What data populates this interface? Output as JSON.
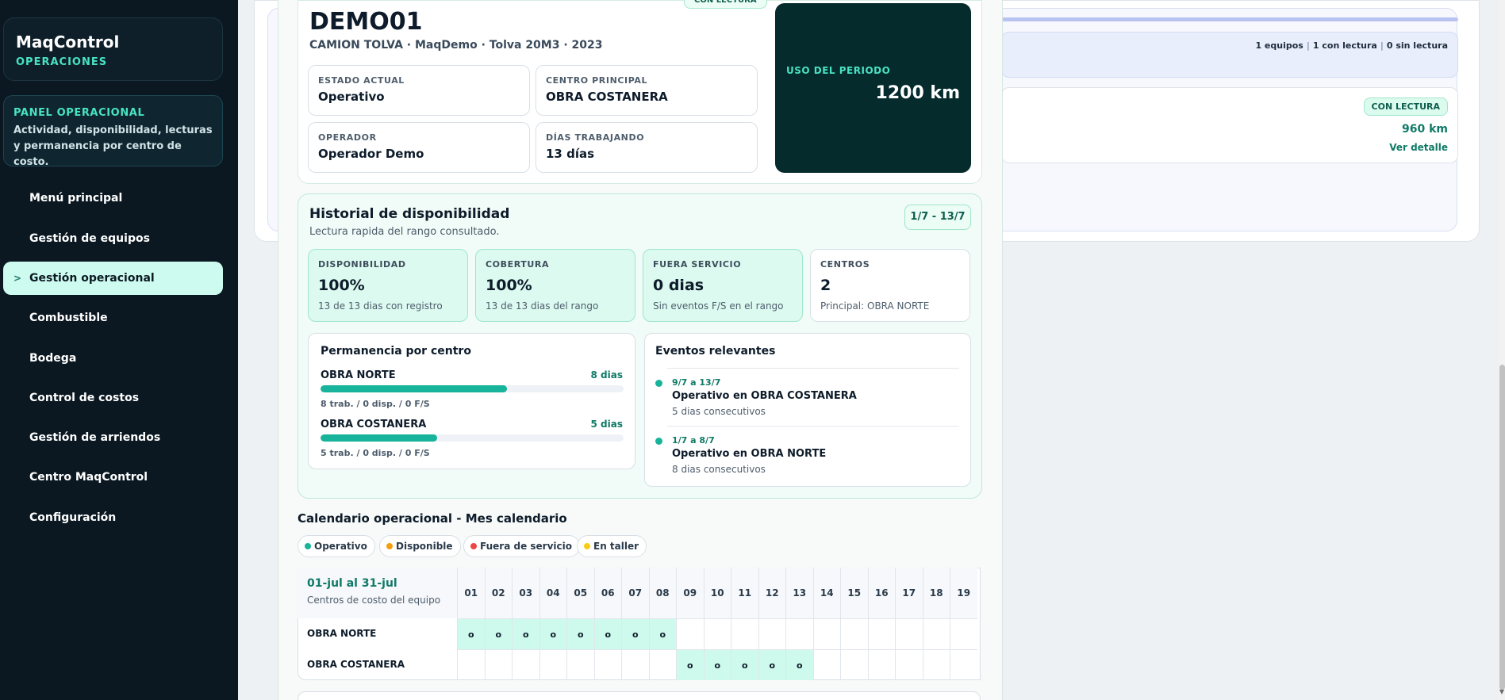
{
  "sidebar": {
    "brand": "MaqControl",
    "brand_sub": "OPERACIONES",
    "panel_title": "PANEL OPERACIONAL",
    "panel_desc": "Actividad, disponibilidad, lecturas y permanencia por centro de costo.",
    "items": [
      {
        "label": "Menú principal"
      },
      {
        "label": "Gestión de equipos"
      },
      {
        "label": "Gestión operacional",
        "active": true
      },
      {
        "label": "Combustible"
      },
      {
        "label": "Bodega"
      },
      {
        "label": "Control de costos"
      },
      {
        "label": "Gestión de arriendos"
      },
      {
        "label": "Centro MaqControl"
      },
      {
        "label": "Configuración"
      }
    ],
    "active_caret": ">"
  },
  "background_panel": {
    "summary": [
      "1 equipos",
      "1 con lectura",
      "0 sin lectura"
    ],
    "summary_sep": "|",
    "item_badge": "CON LECTURA",
    "item_km": "960 km",
    "item_link": "Ver detalle"
  },
  "equipment": {
    "badge": "CON LECTURA",
    "code": "DEMO01",
    "description": "CAMION TOLVA · MaqDemo · Tolva 20M3 · 2023",
    "fields": [
      {
        "label": "ESTADO ACTUAL",
        "value": "Operativo"
      },
      {
        "label": "CENTRO PRINCIPAL",
        "value": "OBRA COSTANERA"
      },
      {
        "label": "OPERADOR",
        "value": "Operador Demo"
      },
      {
        "label": "DÍAS TRABAJANDO",
        "value": "13 días"
      }
    ],
    "usage_label": "USO DEL PERIODO",
    "usage_value": "1200 km"
  },
  "history": {
    "title": "Historial de disponibilidad",
    "subtitle": "Lectura rapida del rango consultado.",
    "range": "1/7 - 13/7",
    "kpis": [
      {
        "label": "DISPONIBILIDAD",
        "value": "100%",
        "note": "13 de 13 dias con registro"
      },
      {
        "label": "COBERTURA",
        "value": "100%",
        "note": "13 de 13 dias del rango"
      },
      {
        "label": "FUERA SERVICIO",
        "value": "0 dias",
        "note": "Sin eventos F/S en el rango"
      },
      {
        "label": "CENTROS",
        "value": "2",
        "note": "Principal: OBRA NORTE"
      }
    ],
    "permanence_title": "Permanencia por centro",
    "permanence": [
      {
        "name": "OBRA NORTE",
        "days": "8 dias",
        "fraction": 0.615,
        "note": "8 trab. / 0 disp. / 0 F/S"
      },
      {
        "name": "OBRA COSTANERA",
        "days": "5 dias",
        "fraction": 0.385,
        "note": "5 trab. / 0 disp. / 0 F/S"
      }
    ],
    "events_title": "Eventos relevantes",
    "events": [
      {
        "date": "9/7 a 13/7",
        "title": "Operativo en OBRA COSTANERA",
        "sub": "5 dias consecutivos"
      },
      {
        "date": "1/7 a 8/7",
        "title": "Operativo en OBRA NORTE",
        "sub": "8 dias consecutivos"
      }
    ]
  },
  "calendar": {
    "title": "Calendario operacional - Mes calendario",
    "legend": [
      {
        "label": "Operativo",
        "color": "#17b39a"
      },
      {
        "label": "Disponible",
        "color": "#f59e0b"
      },
      {
        "label": "Fuera de servicio",
        "color": "#ef4444"
      },
      {
        "label": "En taller",
        "color": "#facc15"
      }
    ],
    "range": "01-jul al 31-jul",
    "range_sub": "Centros de costo del equipo",
    "days": [
      "01",
      "02",
      "03",
      "04",
      "05",
      "06",
      "07",
      "08",
      "09",
      "10",
      "11",
      "12",
      "13",
      "14",
      "15",
      "16",
      "17",
      "18",
      "19"
    ],
    "mark": "o",
    "rows": [
      {
        "name": "OBRA NORTE",
        "active_days": [
          "01",
          "02",
          "03",
          "04",
          "05",
          "06",
          "07",
          "08"
        ]
      },
      {
        "name": "OBRA COSTANERA",
        "active_days": [
          "09",
          "10",
          "11",
          "12",
          "13"
        ]
      }
    ]
  }
}
